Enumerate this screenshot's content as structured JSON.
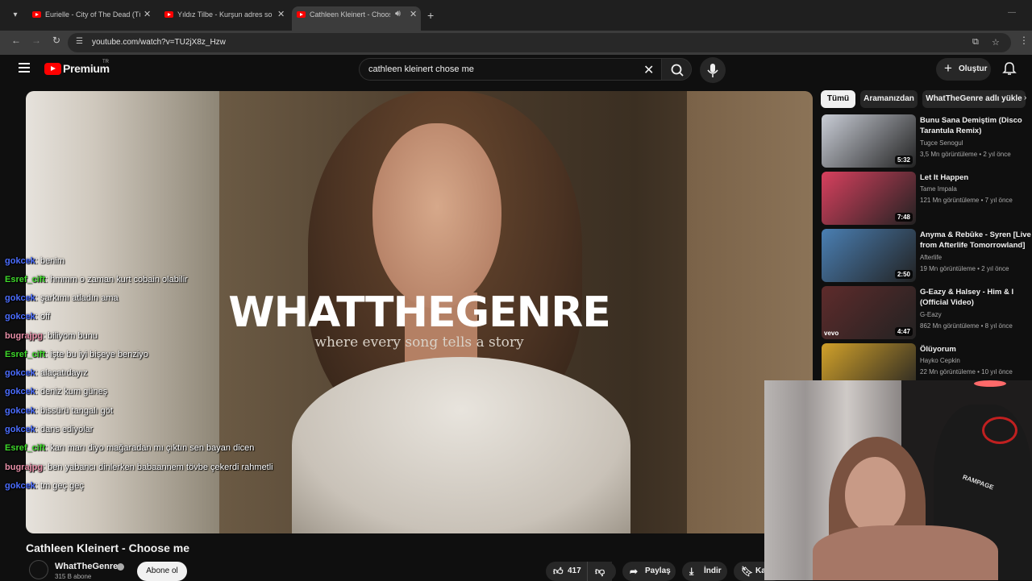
{
  "browser": {
    "tabs": [
      {
        "title": "Eurielle - City of The Dead (Türk"
      },
      {
        "title": "Yıldız Tilbe - Kurşun adres sorm"
      },
      {
        "title": "Cathleen Kleinert - Choose"
      }
    ],
    "url": "youtube.com/watch?v=TU2jX8z_Hzw"
  },
  "header": {
    "logo": "Premium",
    "country": "TR",
    "search_query": "cathleen kleinert chose me",
    "create_label": "Oluştur"
  },
  "player": {
    "overlay_title": "WHATTHEGENRE",
    "overlay_subtitle": "where every song tells a story"
  },
  "chat": [
    {
      "user": "gokcek",
      "color": "#4b6dff",
      "message": ": benim"
    },
    {
      "user": "Esref_cift",
      "color": "#3fd92b",
      "message": ": hmmm o zaman kurt cobain olabilir"
    },
    {
      "user": "gokcek",
      "color": "#4b6dff",
      "message": ": şarkımı atladın ama"
    },
    {
      "user": "gokcek",
      "color": "#4b6dff",
      "message": ": off"
    },
    {
      "user": "bugrajpg",
      "color": "#e88fa8",
      "message": ": biliyom bunu"
    },
    {
      "user": "Esref_cift",
      "color": "#3fd92b",
      "message": ": işte bu iyi bişeye benziyo"
    },
    {
      "user": "gokcek",
      "color": "#4b6dff",
      "message": ": alaçatıdayız"
    },
    {
      "user": "gokcek",
      "color": "#4b6dff",
      "message": ": deniz kum güneş"
    },
    {
      "user": "gokcek",
      "color": "#4b6dff",
      "message": ": bissürü tangalı göt"
    },
    {
      "user": "gokcek",
      "color": "#4b6dff",
      "message": ": dans ediyolar"
    },
    {
      "user": "Esref_cift",
      "color": "#3fd92b",
      "message": ": karı marı diyo mağaradan mı çıktın sen bayan dicen"
    },
    {
      "user": "bugrajpg",
      "color": "#e88fa8",
      "message": ": ben yabancı dinlerken babaannem tövbe çekerdi rahmetli"
    },
    {
      "user": "gokcek",
      "color": "#4b6dff",
      "message": ": tm geç geç"
    }
  ],
  "video": {
    "title": "Cathleen Kleinert - Choose me",
    "channel": "WhatTheGenre",
    "subscribers": "315 B abone",
    "subscribe_label": "Abone ol",
    "likes": "417",
    "share_label": "Paylaş",
    "download_label": "İndir",
    "save_label": "Ka"
  },
  "chips": [
    "Tümü",
    "Aramanızdan",
    "WhatTheGenre adlı yükle"
  ],
  "recommendations": [
    {
      "title": "Bunu Sana Demiştim (Disco Tarantula Remix)",
      "channel": "Tugce Senogul",
      "meta": "3,5 Mn görüntüleme • 2 yıl önce",
      "duration": "5:32",
      "thumb_color": "#c9cdd6"
    },
    {
      "title": "Let It Happen",
      "channel": "Tame Impala",
      "meta": "121 Mn görüntüleme • 7 yıl önce",
      "duration": "7:48",
      "thumb_color": "#d8405e"
    },
    {
      "title": "Anyma & Rebūke - Syren [Live from Afterlife Tomorrowland]",
      "channel": "Afterlife",
      "meta": "19 Mn görüntüleme • 2 yıl önce",
      "duration": "2:50",
      "thumb_color": "#4a7fb3"
    },
    {
      "title": "G-Eazy & Halsey - Him & I (Official Video)",
      "channel": "G-Eazy",
      "meta": "862 Mn görüntüleme • 8 yıl önce",
      "duration": "4:47",
      "thumb_color": "#5e2b2b",
      "badge": "vevo"
    },
    {
      "title": "Ölüyorum",
      "channel": "Hayko Cepkin",
      "meta": "22 Mn görüntüleme • 10 yıl önce",
      "duration": "",
      "thumb_color": "#d1a12a"
    }
  ],
  "webcam": {
    "chair_brand": "RAMPAGE"
  }
}
